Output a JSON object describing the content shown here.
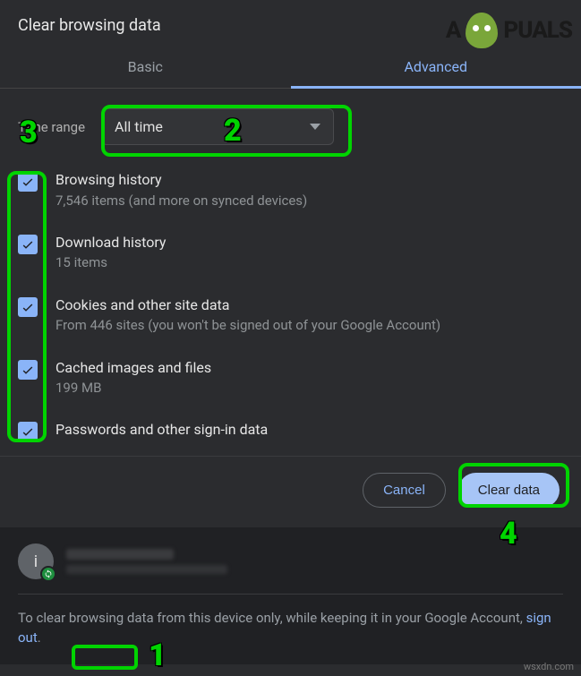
{
  "title": "Clear browsing data",
  "tabs": {
    "basic": "Basic",
    "advanced": "Advanced"
  },
  "timeRange": {
    "label": "Time range",
    "value": "All time"
  },
  "options": [
    {
      "title": "Browsing history",
      "sub": "7,546 items (and more on synced devices)",
      "checked": true
    },
    {
      "title": "Download history",
      "sub": "15 items",
      "checked": true
    },
    {
      "title": "Cookies and other site data",
      "sub": "From 446 sites (you won't be signed out of your Google Account)",
      "checked": true
    },
    {
      "title": "Cached images and files",
      "sub": "199 MB",
      "checked": true
    },
    {
      "title": "Passwords and other sign-in data",
      "sub": "",
      "checked": true
    }
  ],
  "buttons": {
    "cancel": "Cancel",
    "clear": "Clear data"
  },
  "account": {
    "initial": "i"
  },
  "footer": {
    "pre": "To clear browsing data from this device only, while keeping it in your Google Account, ",
    "link": "sign out",
    "post": "."
  },
  "watermark": {
    "pre": "A",
    "post": "PUALS"
  },
  "annotations": {
    "n1": "1",
    "n2": "2",
    "n3": "3",
    "n4": "4"
  },
  "credit": "wsxdn.com"
}
